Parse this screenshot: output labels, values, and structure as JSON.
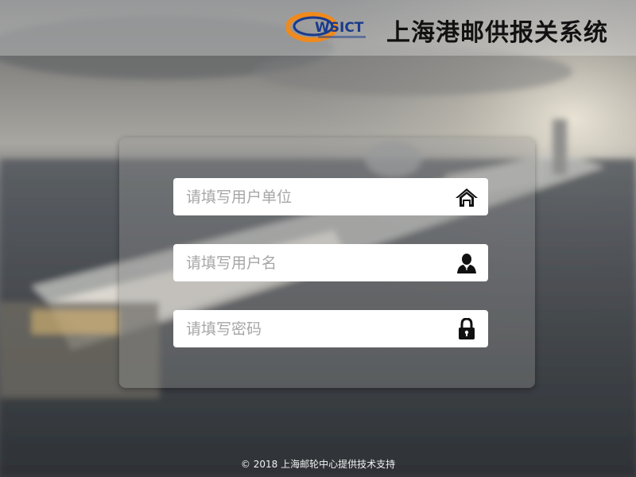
{
  "header": {
    "logo_text": "WSICT",
    "title": "上海港邮供报关系统"
  },
  "form": {
    "unit": {
      "placeholder": "请填写用户单位",
      "value": "",
      "icon": "home-icon"
    },
    "username": {
      "placeholder": "请填写用户名",
      "value": "",
      "icon": "user-icon"
    },
    "password": {
      "placeholder": "请填写密码",
      "value": "",
      "icon": "lock-icon"
    }
  },
  "footer": {
    "text": "© 2018 上海邮轮中心提供技术支持"
  },
  "colors": {
    "title": "#111111",
    "logo_blue": "#1a3b8c",
    "logo_orange": "#f08a1c",
    "field_bg": "#ffffff",
    "placeholder": "#a6a6a6"
  }
}
